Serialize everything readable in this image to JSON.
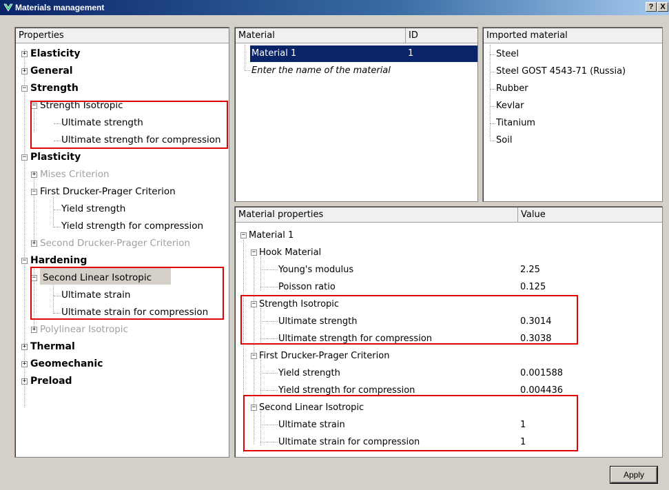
{
  "window": {
    "title": "Materials management",
    "help_label": "?",
    "close_label": "X"
  },
  "properties": {
    "header": "Properties",
    "items": [
      {
        "label": "Elasticity"
      },
      {
        "label": "General"
      },
      {
        "label": "Strength"
      },
      {
        "label": "Strength Isotropic"
      },
      {
        "label": "Ultimate strength"
      },
      {
        "label": "Ultimate strength for compression"
      },
      {
        "label": "Plasticity"
      },
      {
        "label": "Mises Criterion"
      },
      {
        "label": "First Drucker-Prager Criterion"
      },
      {
        "label": "Yield strength"
      },
      {
        "label": "Yield strength for compression"
      },
      {
        "label": "Second Drucker-Prager Criterion"
      },
      {
        "label": "Hardening"
      },
      {
        "label": "Second Linear Isotropic"
      },
      {
        "label": "Ultimate strain"
      },
      {
        "label": "Ultimate strain for compression"
      },
      {
        "label": "Polylinear Isotropic"
      },
      {
        "label": "Thermal"
      },
      {
        "label": "Geomechanic"
      },
      {
        "label": "Preload"
      }
    ]
  },
  "materials": {
    "col_material": "Material",
    "col_id": "ID",
    "rows": [
      {
        "name": "Material 1",
        "id": "1"
      }
    ],
    "placeholder": "Enter the name of the material"
  },
  "imported": {
    "header": "Imported material",
    "items": [
      "Steel",
      "Steel GOST 4543-71 (Russia)",
      "Rubber",
      "Kevlar",
      "Titanium",
      "Soil"
    ]
  },
  "mat_props": {
    "col_props": "Material properties",
    "col_value": "Value",
    "rows": [
      {
        "label": "Material 1",
        "value": ""
      },
      {
        "label": "Hook Material",
        "value": ""
      },
      {
        "label": "Young's modulus",
        "value": "2.25"
      },
      {
        "label": "Poisson ratio",
        "value": "0.125"
      },
      {
        "label": "Strength Isotropic",
        "value": ""
      },
      {
        "label": "Ultimate strength",
        "value": "0.3014"
      },
      {
        "label": "Ultimate strength for compression",
        "value": "0.3038"
      },
      {
        "label": "First Drucker-Prager Criterion",
        "value": ""
      },
      {
        "label": "Yield strength",
        "value": "0.001588"
      },
      {
        "label": "Yield strength for compression",
        "value": "0.004436"
      },
      {
        "label": "Second Linear Isotropic",
        "value": ""
      },
      {
        "label": "Ultimate strain",
        "value": "1"
      },
      {
        "label": "Ultimate strain for compression",
        "value": "1"
      }
    ]
  },
  "footer": {
    "apply_label": "Apply"
  },
  "colors": {
    "highlight": "#e00000",
    "selection": "#0a246a"
  }
}
